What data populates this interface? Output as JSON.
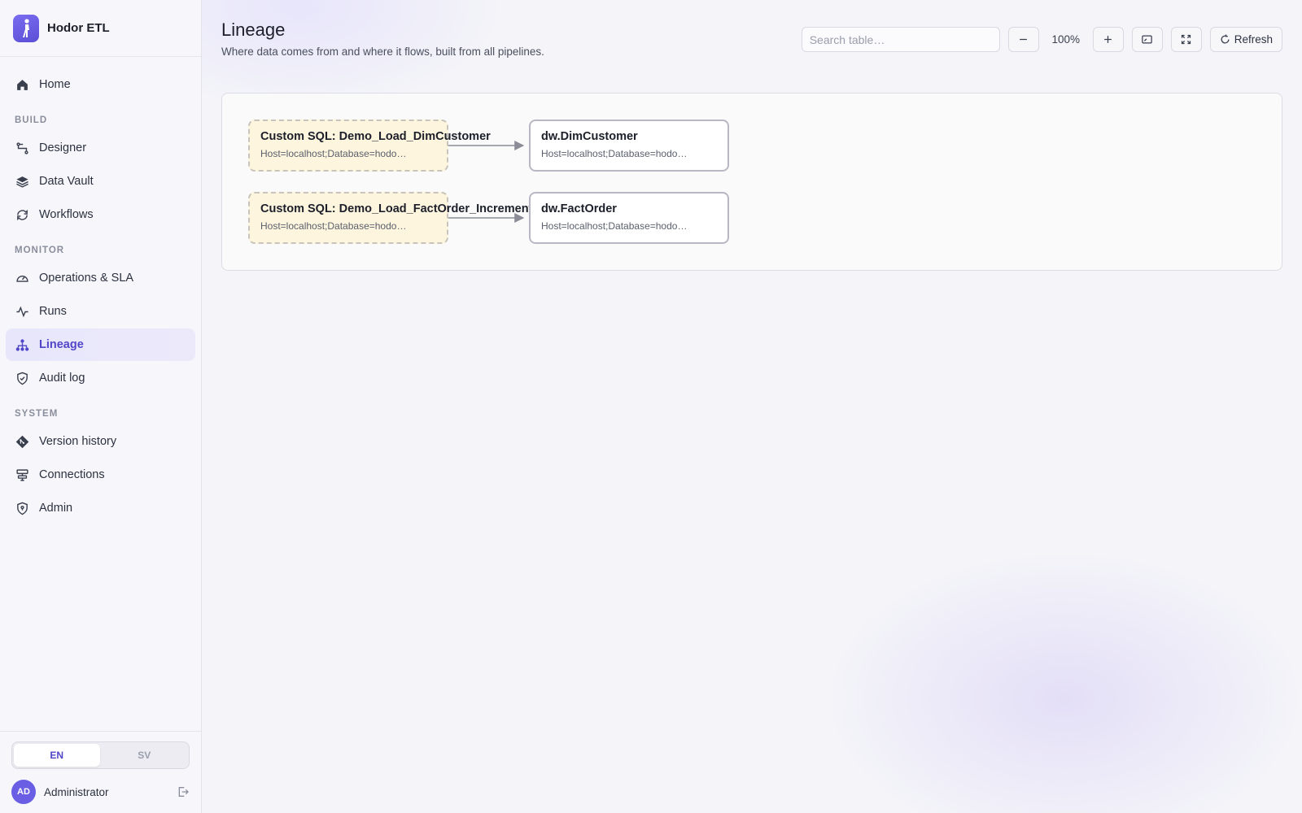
{
  "brand": {
    "name": "Hodor ETL"
  },
  "sidebar": {
    "home": "Home",
    "sections": {
      "build": "BUILD",
      "monitor": "MONITOR",
      "system": "SYSTEM"
    },
    "items": {
      "designer": "Designer",
      "data_vault": "Data Vault",
      "workflows": "Workflows",
      "operations": "Operations & SLA",
      "runs": "Runs",
      "lineage": "Lineage",
      "audit_log": "Audit log",
      "version_history": "Version history",
      "connections": "Connections",
      "admin": "Admin"
    },
    "active_item": "lineage",
    "language": {
      "en": "EN",
      "sv": "SV",
      "selected": "EN"
    },
    "user": {
      "initials": "AD",
      "name": "Administrator"
    }
  },
  "header": {
    "title": "Lineage",
    "subtitle": "Where data comes from and where it flows, built from all pipelines."
  },
  "toolbar": {
    "search_placeholder": "Search table…",
    "zoom_level": "100%",
    "refresh_label": "Refresh"
  },
  "lineage": {
    "nodes": [
      {
        "id": "src1",
        "kind": "source",
        "title": "Custom SQL: Demo_Load_DimCustomer",
        "subtitle": "Host=localhost;Database=hodo…"
      },
      {
        "id": "tgt1",
        "kind": "target",
        "title": "dw.DimCustomer",
        "subtitle": "Host=localhost;Database=hodo…"
      },
      {
        "id": "src2",
        "kind": "source",
        "title": "Custom SQL: Demo_Load_FactOrder_Incremental",
        "subtitle": "Host=localhost;Database=hodo…"
      },
      {
        "id": "tgt2",
        "kind": "target",
        "title": "dw.FactOrder",
        "subtitle": "Host=localhost;Database=hodo…"
      }
    ],
    "edges": [
      {
        "from": "src1",
        "to": "tgt1"
      },
      {
        "from": "src2",
        "to": "tgt2"
      }
    ],
    "colors": {
      "source_fill": "#fdf5dd",
      "edge": "#8a8d96",
      "accent": "#5046c8"
    }
  }
}
